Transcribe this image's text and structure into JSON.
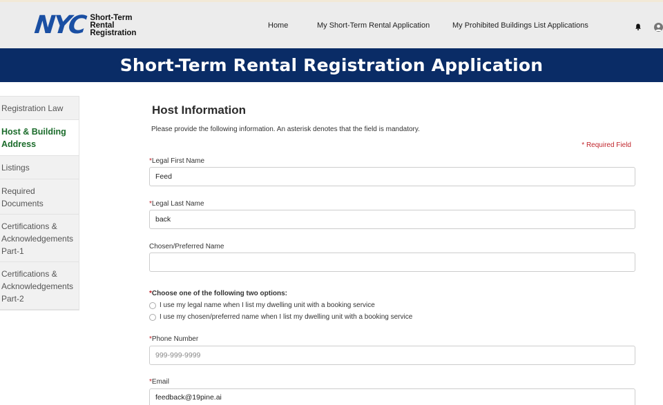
{
  "header": {
    "logo_mark": "NYC",
    "logo_line1": "Short-Term",
    "logo_line2": "Rental",
    "logo_line3": "Registration",
    "nav": [
      "Home",
      "My Short-Term Rental Application",
      "My Prohibited Buildings List Applications"
    ],
    "icons": [
      "bell-icon",
      "user-icon"
    ]
  },
  "banner": {
    "title": "Short-Term Rental Registration Application"
  },
  "sidebar": {
    "items": [
      {
        "label": "Registration Law",
        "active": false
      },
      {
        "label": "Host & Building Address",
        "active": true
      },
      {
        "label": "Listings",
        "active": false
      },
      {
        "label": "Required Documents",
        "active": false
      },
      {
        "label": "Certifications & Acknowledgements Part-1",
        "active": false
      },
      {
        "label": "Certifications & Acknowledgements Part-2",
        "active": false
      }
    ]
  },
  "form": {
    "title": "Host Information",
    "intro": "Please provide the following information. An asterisk denotes that the field is mandatory.",
    "required_note": "*  Required Field",
    "first_name": {
      "label": "Legal First Name",
      "required": "*",
      "value": "Feed"
    },
    "last_name": {
      "label": "Legal Last Name",
      "required": "*",
      "value": "back"
    },
    "preferred_name": {
      "label": "Chosen/Preferred Name",
      "value": ""
    },
    "name_choice": {
      "label": "Choose one of the following two options:",
      "required": "*",
      "options": [
        "I use my legal name when I list my dwelling unit with a booking service",
        "I use my chosen/preferred name when I list my dwelling unit with a booking service"
      ]
    },
    "phone": {
      "label": "Phone Number",
      "required": "*",
      "placeholder": "999-999-9999"
    },
    "email": {
      "label": "Email",
      "required": "*",
      "value": "feedback@19pine.ai"
    }
  },
  "colors": {
    "banner": "#0a2c66",
    "logo": "#1a4fa3",
    "active_nav": "#1a6b2a",
    "required": "#c0242b"
  }
}
